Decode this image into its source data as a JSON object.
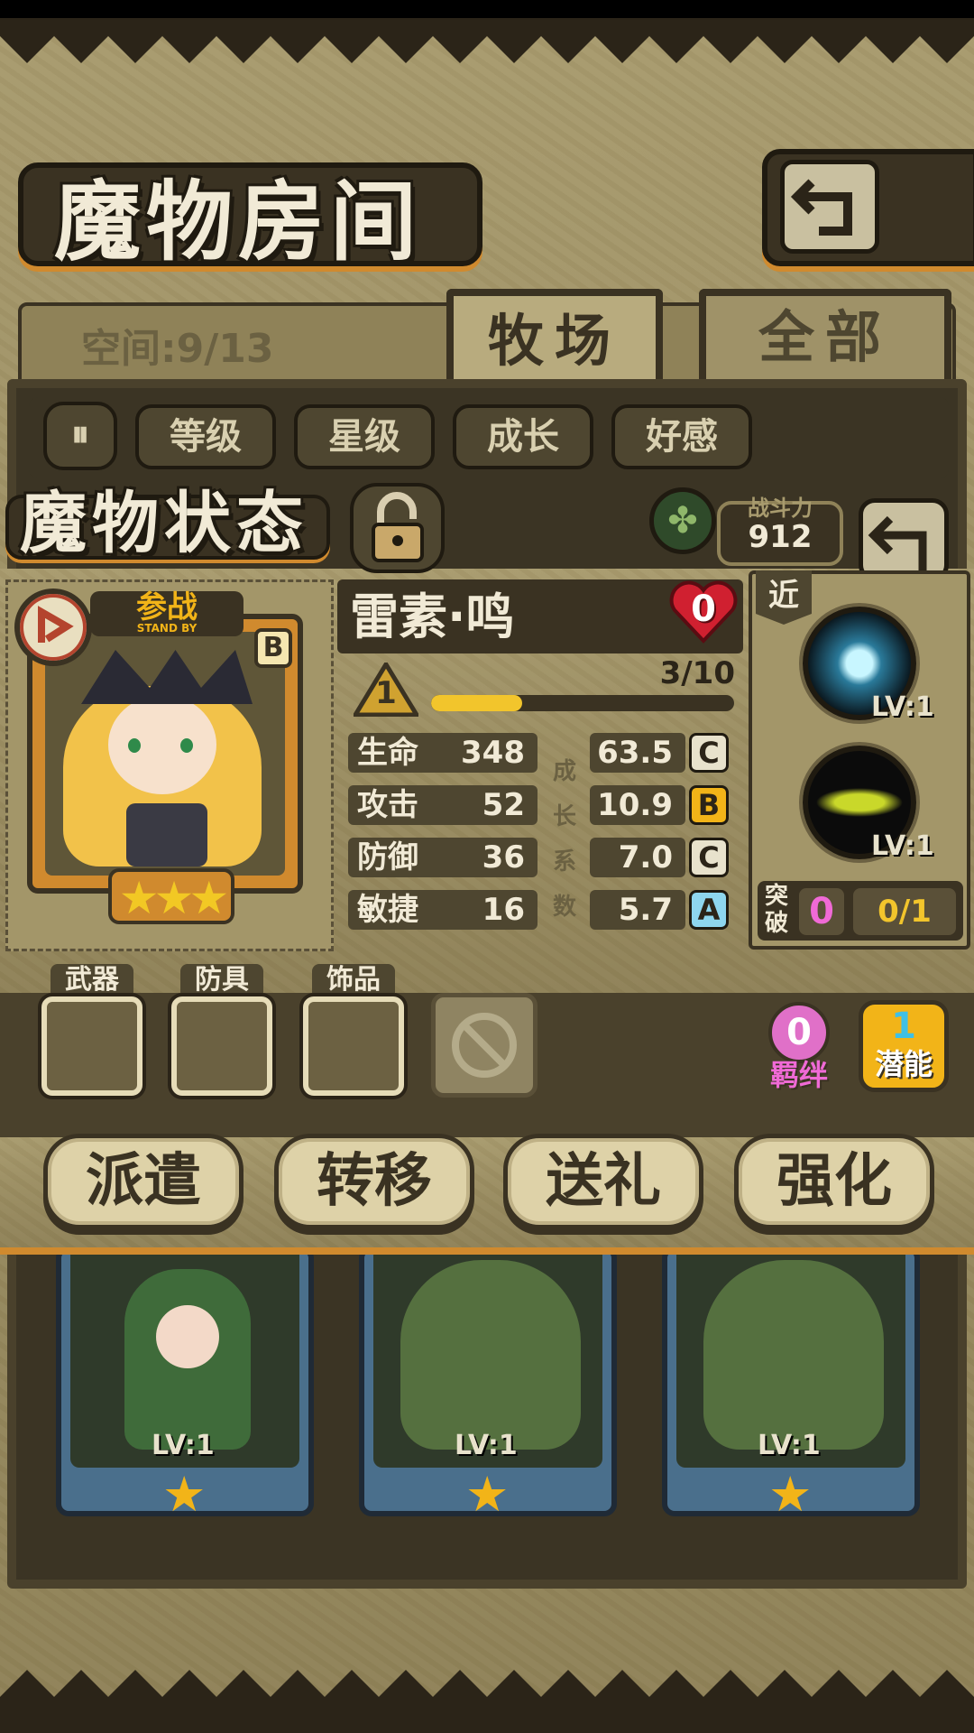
{
  "header": {
    "title": "魔物房间"
  },
  "storage": {
    "space_label": "空间:9/13"
  },
  "tabs": [
    {
      "label": "牧场"
    },
    {
      "label": "全部"
    }
  ],
  "sort": {
    "toggle_icon": "pause-sort-icon",
    "options": [
      "等级",
      "星级",
      "成长",
      "好感"
    ]
  },
  "status_panel": {
    "title": "魔物状态",
    "power_label": "战斗力",
    "power_value": "912",
    "monster": {
      "name": "雷素·鸣",
      "rank": "B",
      "standby_label": "参战",
      "standby_sub": "STAND BY",
      "stars": 3,
      "level": "1",
      "exp_text": "3/10",
      "exp_fraction": 0.3,
      "affection": "0",
      "stats": [
        {
          "label": "生命",
          "value": "348",
          "growth": "63.5",
          "grade": "C"
        },
        {
          "label": "攻击",
          "value": "52",
          "growth": "10.9",
          "grade": "B"
        },
        {
          "label": "防御",
          "value": "36",
          "growth": "7.0",
          "grade": "C"
        },
        {
          "label": "敏捷",
          "value": "16",
          "growth": "5.7",
          "grade": "A"
        }
      ],
      "growth_vertical": [
        "成",
        "长",
        "系",
        "数"
      ],
      "attack_type": "近",
      "skills": [
        {
          "lv": "LV:1"
        },
        {
          "lv": "LV:1"
        }
      ],
      "breakthrough_label": "突破",
      "breakthrough_count": "0",
      "breakthrough_progress": "0/1"
    },
    "equipment": [
      {
        "label": "武器"
      },
      {
        "label": "防具"
      },
      {
        "label": "饰品"
      }
    ],
    "bond": {
      "value": "0",
      "label": "羁绊"
    },
    "potential": {
      "value": "1",
      "label": "潜能"
    },
    "actions": [
      "派遣",
      "转移",
      "送礼",
      "强化"
    ]
  },
  "cards": [
    {
      "lv": "LV:1"
    },
    {
      "lv": "LV:1"
    },
    {
      "lv": "LV:1"
    }
  ],
  "colors": {
    "accent": "#d08a2e",
    "parchment": "#9c8f63",
    "dark": "#2b2418"
  }
}
